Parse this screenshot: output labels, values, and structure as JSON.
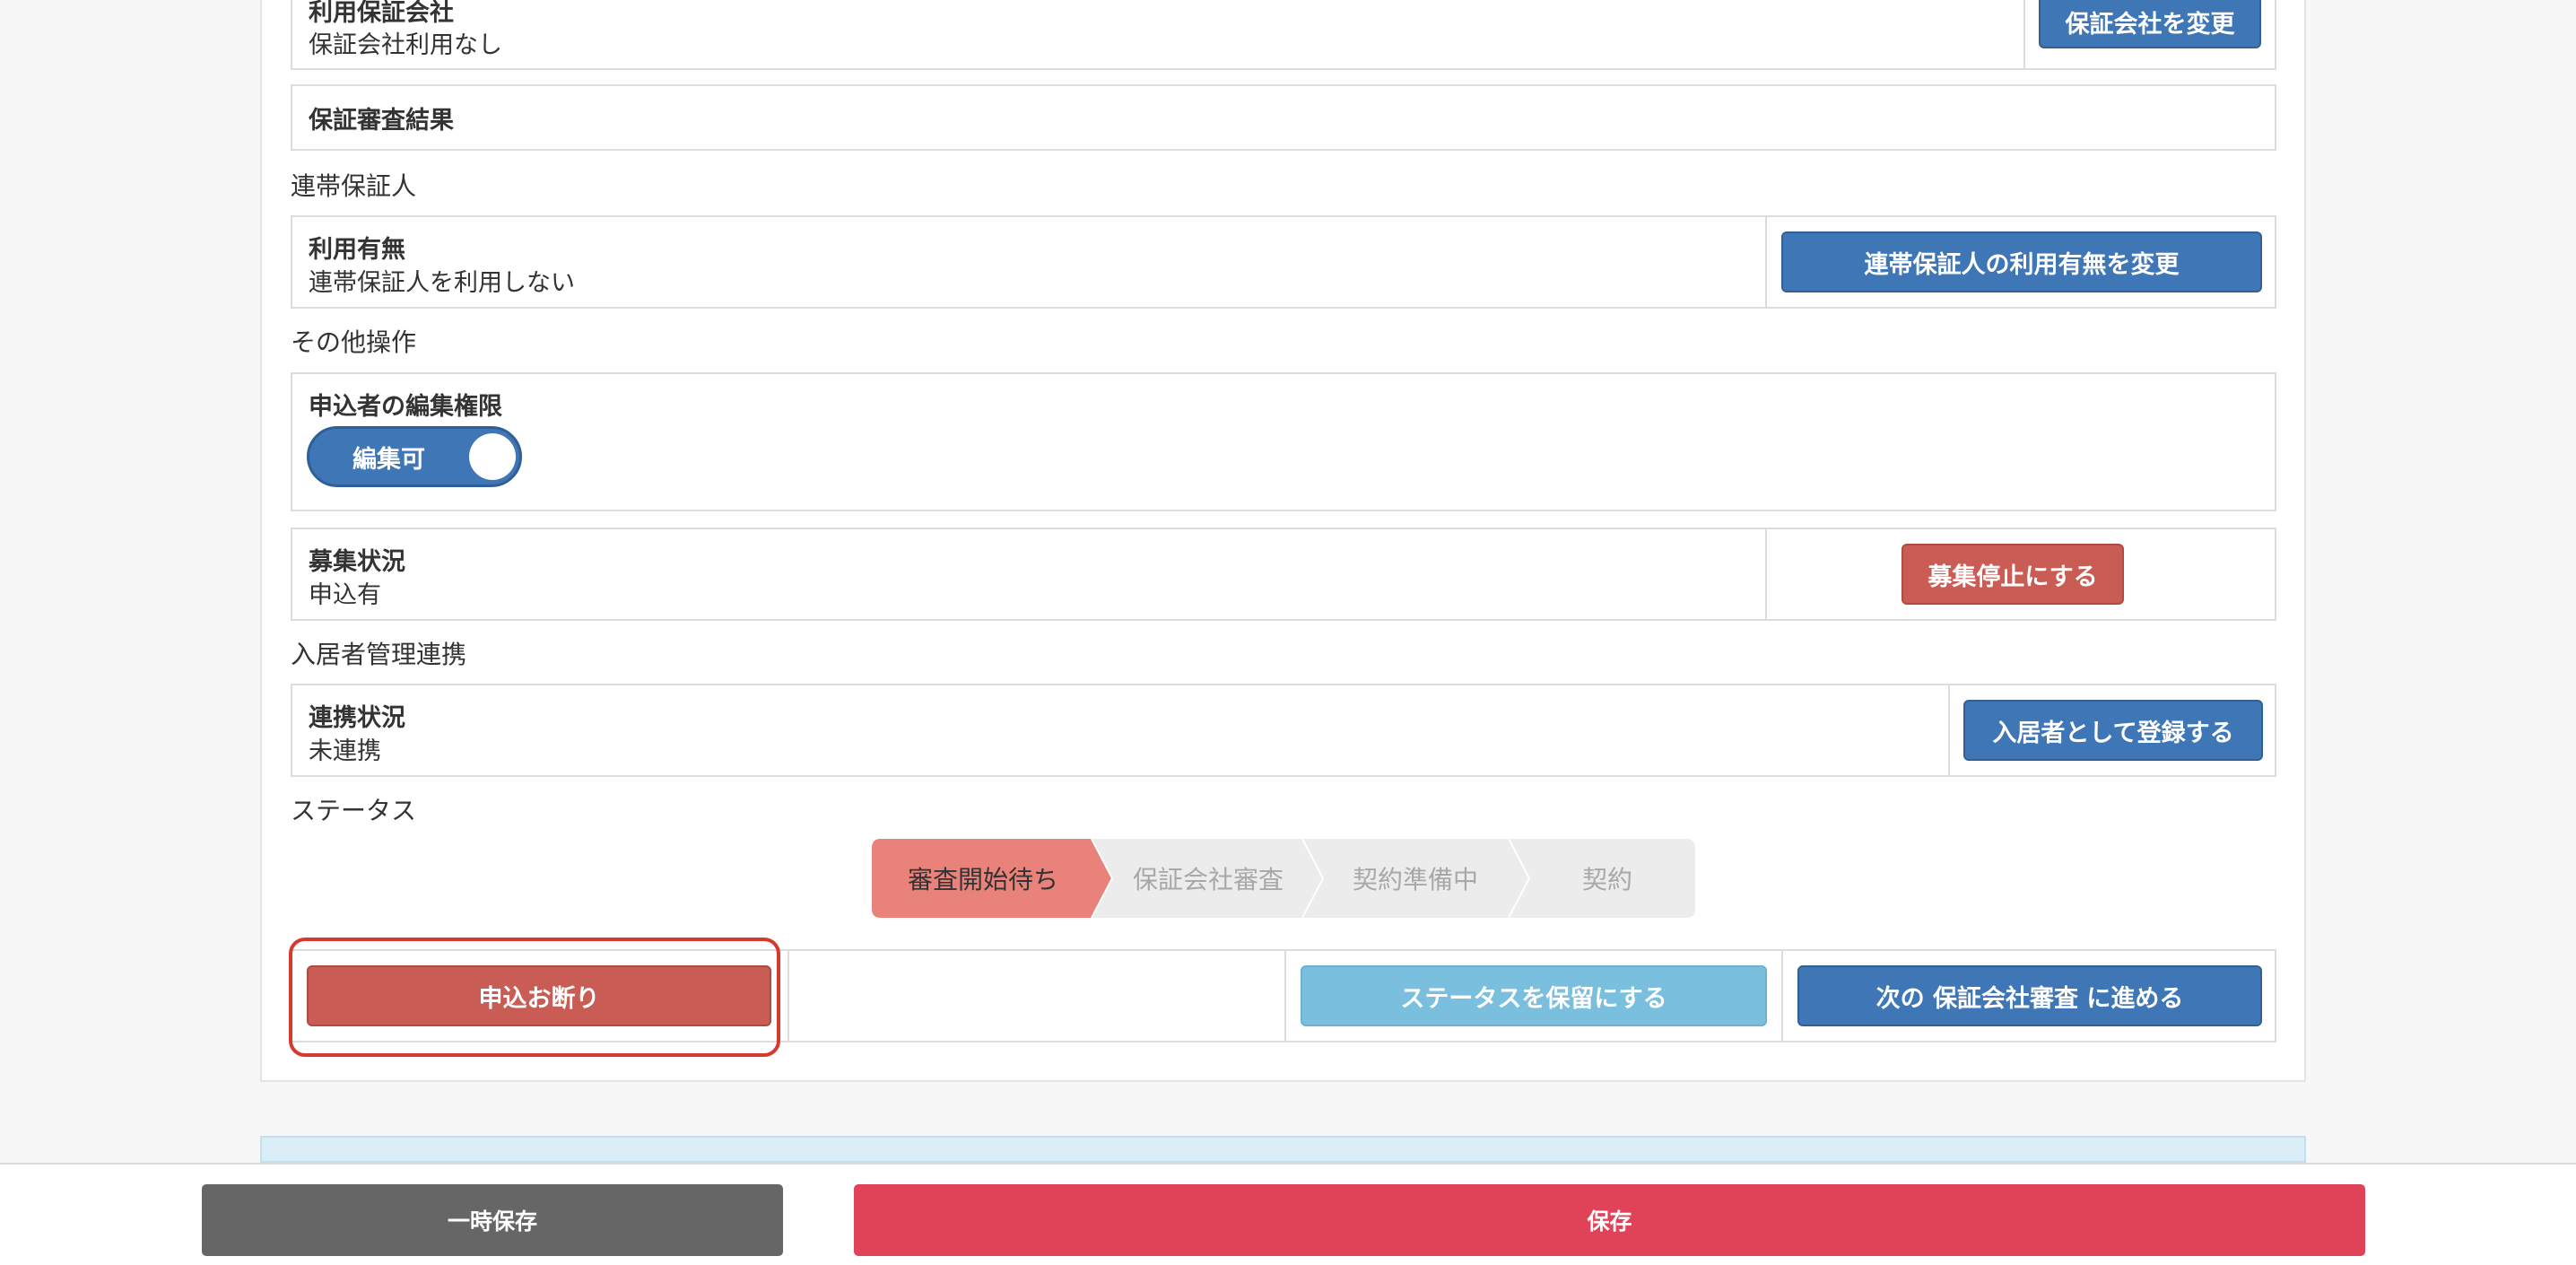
{
  "guarantor_company": {
    "title": "利用保証会社",
    "value": "保証会社利用なし",
    "button": "保証会社を変更"
  },
  "guarantee_result": {
    "title": "保証審査結果"
  },
  "joint_guarantor": {
    "section": "連帯保証人",
    "title": "利用有無",
    "value": "連帯保証人を利用しない",
    "button": "連帯保証人の利用有無を変更"
  },
  "other_ops": {
    "section": "その他操作",
    "edit_permission": {
      "title": "申込者の編集権限",
      "toggle_label": "編集可",
      "toggle_on": true
    },
    "recruitment": {
      "title": "募集状況",
      "value": "申込有",
      "button": "募集停止にする"
    }
  },
  "resident_link": {
    "section": "入居者管理連携",
    "title": "連携状況",
    "value": "未連携",
    "button": "入居者として登録する"
  },
  "status": {
    "section": "ステータス",
    "steps": [
      "審査開始待ち",
      "保証会社審査",
      "契約準備中",
      "契約"
    ],
    "active_step": 0,
    "active_color": "#e8827a",
    "inactive_color": "#ececec"
  },
  "actions": {
    "reject": "申込お断り",
    "hold": "ステータスを保留にする",
    "next": "次の 保証会社審査 に進める"
  },
  "footer": {
    "temp_save": "一時保存",
    "save": "保存",
    "temp_save_color": "#666666",
    "save_color": "#e04358"
  }
}
